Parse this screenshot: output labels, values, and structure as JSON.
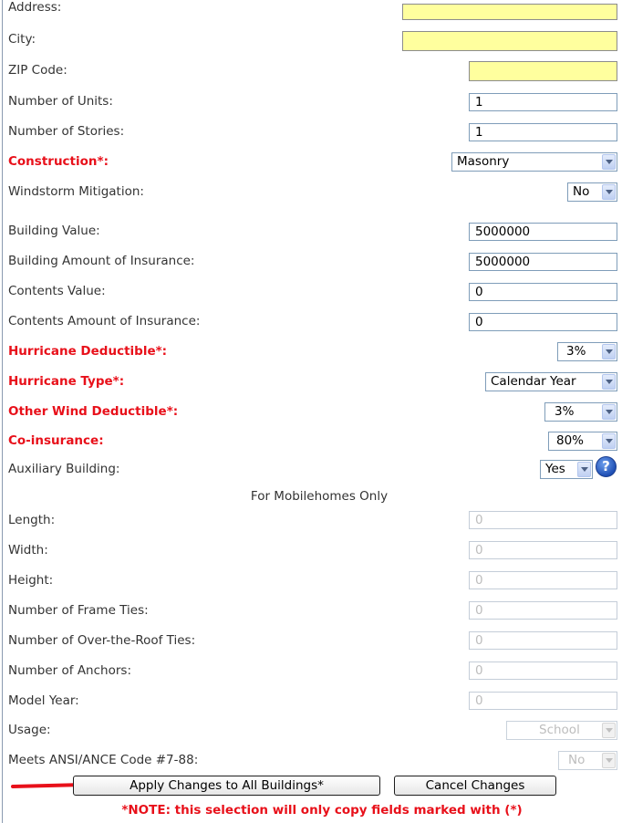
{
  "fields": {
    "address": {
      "label": "Address:",
      "value": ""
    },
    "city": {
      "label": "City:",
      "value": ""
    },
    "zip": {
      "label": "ZIP Code:",
      "value": ""
    },
    "units": {
      "label": "Number of Units:",
      "value": "1"
    },
    "stories": {
      "label": "Number of Stories:",
      "value": "1"
    },
    "construction": {
      "label": "Construction*:",
      "value": "Masonry"
    },
    "windstorm": {
      "label": "Windstorm Mitigation:",
      "value": "No"
    },
    "building_value": {
      "label": "Building Value:",
      "value": "5000000"
    },
    "building_insurance": {
      "label": "Building Amount of Insurance:",
      "value": "5000000"
    },
    "contents_value": {
      "label": "Contents Value:",
      "value": "0"
    },
    "contents_insurance": {
      "label": "Contents Amount of Insurance:",
      "value": "0"
    },
    "hurricane_deductible": {
      "label": "Hurricane Deductible*:",
      "value": "3%"
    },
    "hurricane_type": {
      "label": "Hurricane Type*:",
      "value": "Calendar Year"
    },
    "other_wind": {
      "label": "Other Wind Deductible*:",
      "value": "3%"
    },
    "coinsurance": {
      "label": "Co-insurance:",
      "value": "80%"
    },
    "auxiliary": {
      "label": "Auxiliary Building:",
      "value": "Yes"
    }
  },
  "mobile": {
    "heading": "For Mobilehomes Only",
    "length": {
      "label": "Length:",
      "value": "0"
    },
    "width": {
      "label": "Width:",
      "value": "0"
    },
    "height": {
      "label": "Height:",
      "value": "0"
    },
    "frame_ties": {
      "label": "Number of Frame Ties:",
      "value": "0"
    },
    "roof_ties": {
      "label": "Number of Over-the-Roof Ties:",
      "value": "0"
    },
    "anchors": {
      "label": "Number of Anchors:",
      "value": "0"
    },
    "model_year": {
      "label": "Model Year:",
      "value": "0"
    },
    "usage": {
      "label": "Usage:",
      "value": "School"
    },
    "ansi": {
      "label": "Meets ANSI/ANCE Code #7-88:",
      "value": "No"
    }
  },
  "buttons": {
    "apply": "Apply Changes to All Buildings*",
    "cancel": "Cancel Changes"
  },
  "note": "*NOTE: this selection will only copy fields marked with (*)",
  "colors": {
    "required": "#e8101a",
    "highlight": "#ffff9e",
    "arrow": "#e8101a"
  },
  "icons": {
    "help": "help-icon",
    "dropdown": "chevron-down-icon",
    "pointer": "red-arrow-icon"
  }
}
